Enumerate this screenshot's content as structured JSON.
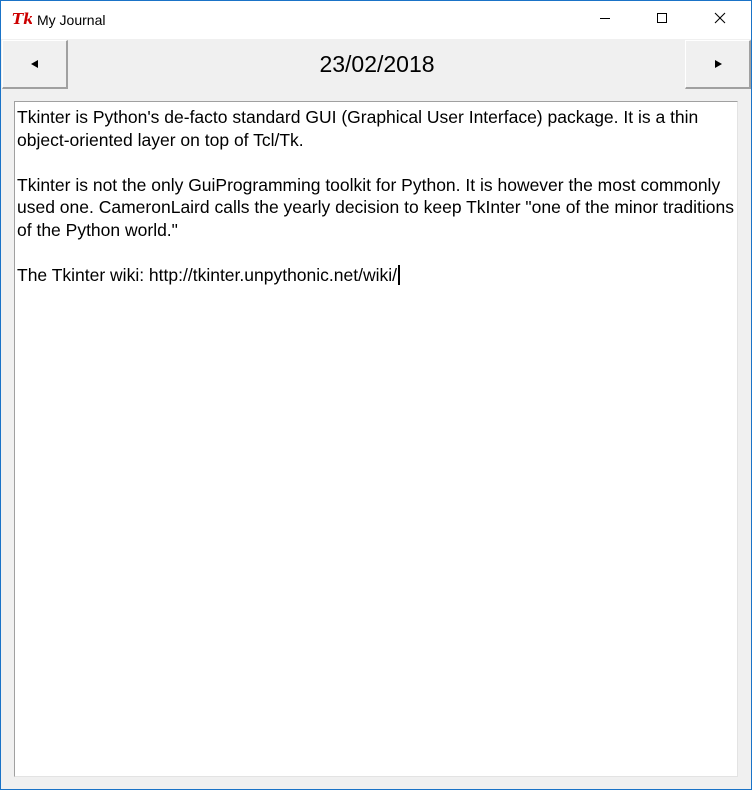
{
  "window": {
    "title": "My Journal",
    "app_icon": "tk-feather-icon",
    "controls": [
      "minimize-icon",
      "maximize-icon",
      "close-icon"
    ]
  },
  "toolbar": {
    "prev_icon": "left-triangle-icon",
    "next_icon": "right-triangle-icon",
    "date": "23/02/2018"
  },
  "editor": {
    "paragraphs": [
      "Tkinter is Python's de-facto standard GUI (Graphical User Interface) package. It is a thin object-oriented layer on top of Tcl/Tk.",
      "Tkinter is not the only GuiProgramming toolkit for Python. It is however the most commonly used one. CameronLaird calls the yearly decision to keep TkInter \"one of the minor traditions of the Python world.\"",
      "The Tkinter wiki: http://tkinter.unpythonic.net/wiki/"
    ]
  },
  "colors": {
    "window_border": "#1a73c7",
    "tk_icon_red": "#cc0000"
  }
}
